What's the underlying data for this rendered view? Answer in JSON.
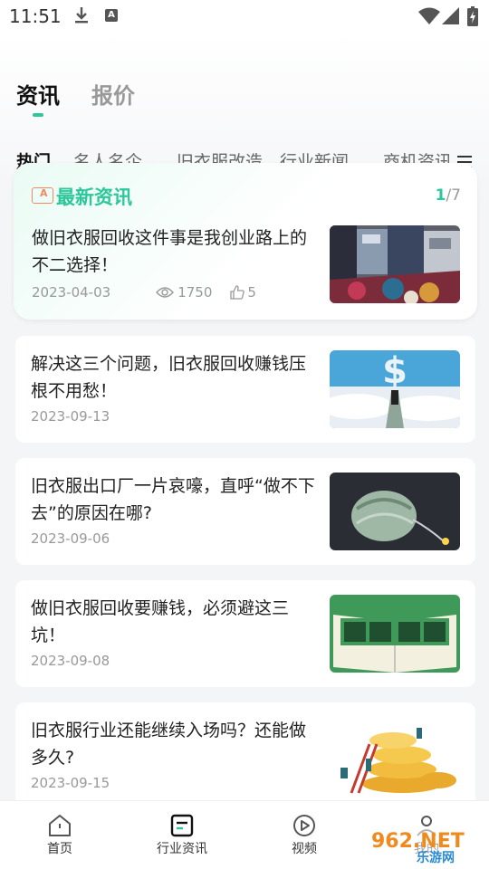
{
  "status_bar": {
    "time": "11:51",
    "badge": "A"
  },
  "header": {
    "main_tabs": [
      {
        "label": "资讯"
      },
      {
        "label": "报价"
      }
    ],
    "categories": [
      {
        "label": "热门"
      },
      {
        "label": "名人名企"
      },
      {
        "label": "旧衣服改造"
      },
      {
        "label": "行业新闻"
      },
      {
        "label": "商机资讯"
      }
    ]
  },
  "featured": {
    "section_title": "最新资讯",
    "page_current": "1",
    "page_total": "/7",
    "headline": "做旧衣服回收这件事是我创业路上的不二选择！",
    "date": "2023-04-03",
    "views": "1750",
    "likes": "5"
  },
  "articles": [
    {
      "title": "解决这三个问题，旧衣服回收赚钱压根不用愁！",
      "date": "2023-09-13",
      "image": "money-stairs-clouds"
    },
    {
      "title": "旧衣服出口厂一片哀嚎，直呼“做不下去”的原因在哪?",
      "date": "2023-09-06",
      "image": "money-bomb"
    },
    {
      "title": "做旧衣服回收要赚钱，必须避这三坑！",
      "date": "2023-09-08",
      "image": "book-secret"
    },
    {
      "title": "旧衣服行业还能继续入场吗？还能做多久?",
      "date": "2023-09-15",
      "image": "coins-ladder"
    }
  ],
  "bottom_nav": [
    {
      "label": "首页",
      "icon": "home-icon"
    },
    {
      "label": "行业资讯",
      "icon": "news-icon"
    },
    {
      "label": "视频",
      "icon": "play-icon"
    },
    {
      "label": "我的",
      "icon": "user-icon"
    }
  ],
  "watermark": {
    "text": "962.NET",
    "subtext": "乐游网"
  },
  "colors": {
    "accent": "#2cc79a",
    "icon_orange": "#f08a63",
    "text_gray": "#999999"
  }
}
